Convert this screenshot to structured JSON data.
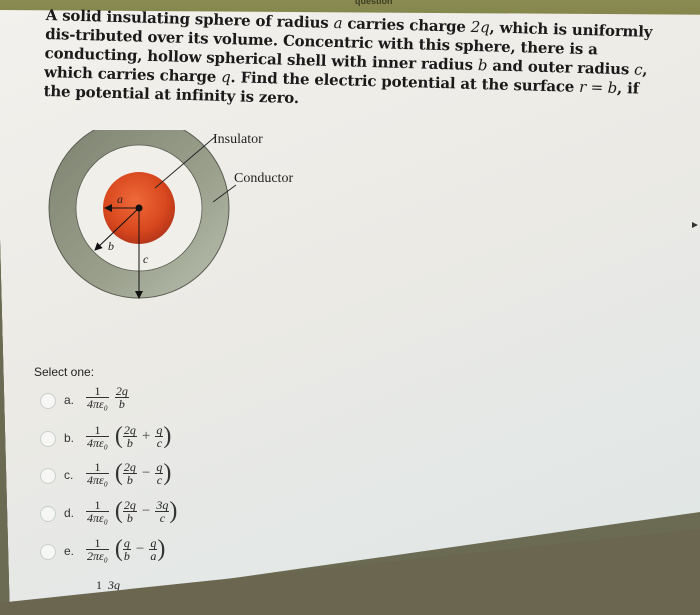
{
  "browser": {
    "tab_label": "question"
  },
  "question": {
    "text_parts": [
      "A solid insulating sphere of radius ",
      "a",
      " carries charge ",
      "2q",
      ", which is uniformly dis-tributed over its volume. Concentric with this sphere, there is a conducting, hollow spherical shell with inner radius ",
      "b",
      " and outer radius ",
      "c",
      ", which carries charge ",
      "q",
      ". Find the electric potential at the surface ",
      "r = b",
      ", if the potential at infinity is zero."
    ]
  },
  "diagram": {
    "labels": {
      "insulator": "Insulator",
      "conductor": "Conductor",
      "a": "a",
      "b": "b",
      "c": "c"
    },
    "colors": {
      "sphere": "#d9481e",
      "shell": "#8e9481",
      "shell_border": "#5a5d52"
    }
  },
  "answers": {
    "prompt": "Select one:",
    "options": [
      {
        "letter": "a.",
        "prefix_num": "1",
        "prefix_den": "4πε₀",
        "terms": [
          {
            "num": "2q",
            "den": "b"
          }
        ],
        "parenthesized": false,
        "selected": false
      },
      {
        "letter": "b.",
        "prefix_num": "1",
        "prefix_den": "4πε₀",
        "terms": [
          {
            "num": "2q",
            "den": "b"
          },
          {
            "op": "+",
            "num": "q",
            "den": "c"
          }
        ],
        "parenthesized": true,
        "selected": false
      },
      {
        "letter": "c.",
        "prefix_num": "1",
        "prefix_den": "4πε₀",
        "terms": [
          {
            "num": "2q",
            "den": "b"
          },
          {
            "op": "−",
            "num": "q",
            "den": "c"
          }
        ],
        "parenthesized": true,
        "selected": false
      },
      {
        "letter": "d.",
        "prefix_num": "1",
        "prefix_den": "4πε₀",
        "terms": [
          {
            "num": "2q",
            "den": "b"
          },
          {
            "op": "−",
            "num": "3q",
            "den": "c"
          }
        ],
        "parenthesized": true,
        "selected": false
      },
      {
        "letter": "e.",
        "prefix_num": "1",
        "prefix_den": "2πε₀",
        "terms": [
          {
            "num": "q",
            "den": "b"
          },
          {
            "op": "−",
            "num": "q",
            "den": "a"
          }
        ],
        "parenthesized": true,
        "selected": false
      }
    ],
    "partial_next": {
      "num1": "1",
      "num2": "3q"
    }
  }
}
